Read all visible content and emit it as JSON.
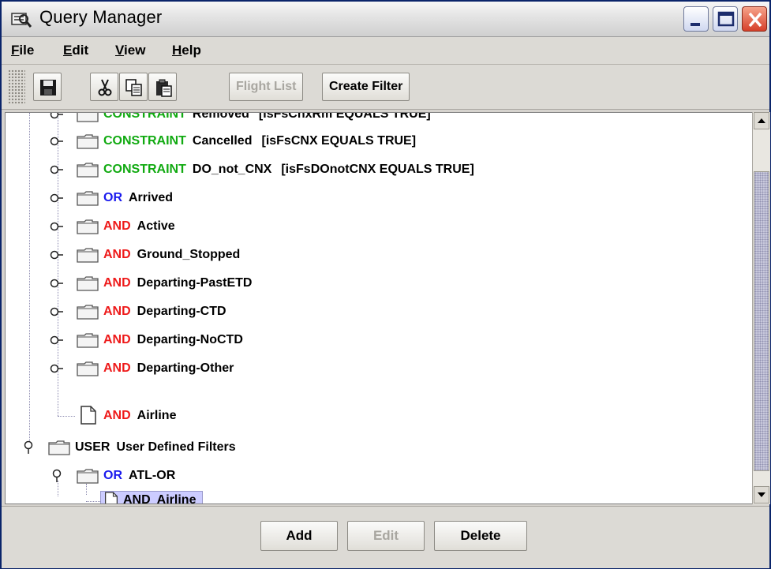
{
  "window": {
    "title": "Query Manager"
  },
  "menu": [
    {
      "label": "File",
      "mnemonic": "F",
      "rest": "ile"
    },
    {
      "label": "Edit",
      "mnemonic": "E",
      "rest": "dit"
    },
    {
      "label": "View",
      "mnemonic": "V",
      "rest": "iew"
    },
    {
      "label": "Help",
      "mnemonic": "H",
      "rest": "elp"
    }
  ],
  "toolbar": {
    "icons": [
      "save-icon",
      "cut-icon",
      "copy-icon",
      "paste-icon"
    ],
    "flight_list": "Flight List",
    "create_filter": "Create Filter"
  },
  "tree": {
    "rows": [
      {
        "kw": "CONSTRAINT",
        "name": "Removed",
        "expr": "[isFsCnxRm EQUALS TRUE]"
      },
      {
        "kw": "CONSTRAINT",
        "name": "Cancelled",
        "expr": "[isFsCNX EQUALS TRUE]"
      },
      {
        "kw": "CONSTRAINT",
        "name": "DO_not_CNX",
        "expr": "[isFsDOnotCNX EQUALS TRUE]"
      },
      {
        "kw": "OR",
        "name": "Arrived"
      },
      {
        "kw": "AND",
        "name": "Active"
      },
      {
        "kw": "AND",
        "name": "Ground_Stopped"
      },
      {
        "kw": "AND",
        "name": "Departing-PastETD"
      },
      {
        "kw": "AND",
        "name": "Departing-CTD"
      },
      {
        "kw": "AND",
        "name": "Departing-NoCTD"
      },
      {
        "kw": "AND",
        "name": "Departing-Other"
      },
      {
        "kw": "AND",
        "name": "Airline"
      },
      {
        "kw": "USER",
        "name": "User Defined Filters"
      },
      {
        "kw": "OR",
        "name": "ATL-OR"
      },
      {
        "kw": "AND",
        "name": "Airline"
      }
    ]
  },
  "buttons": {
    "add": "Add",
    "edit": "Edit",
    "delete": "Delete"
  },
  "colors": {
    "constraint": "#11aa11",
    "or": "#1a1aee",
    "and": "#ee1a1a",
    "selection": "#ccccff"
  }
}
